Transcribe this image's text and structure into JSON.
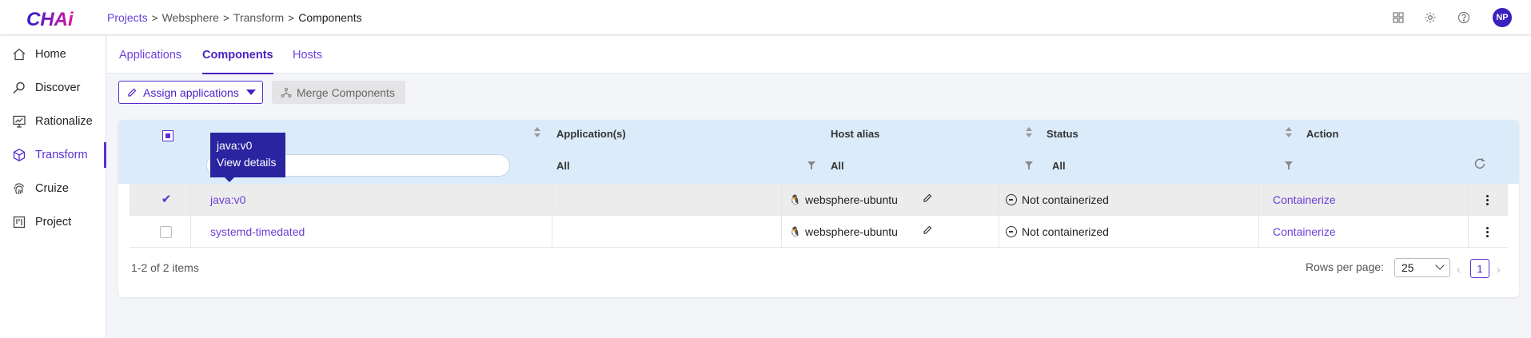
{
  "app": {
    "logo_text": "CHAi"
  },
  "breadcrumb": [
    "Projects",
    "Websphere",
    "Transform",
    "Components"
  ],
  "header_icons": [
    "grid-icon",
    "gear-icon",
    "help-icon"
  ],
  "user": {
    "initials": "NP"
  },
  "sidebar": {
    "items": [
      {
        "label": "Home",
        "icon": "home-icon"
      },
      {
        "label": "Discover",
        "icon": "magnifier-icon"
      },
      {
        "label": "Rationalize",
        "icon": "presentation-icon"
      },
      {
        "label": "Transform",
        "icon": "cube-icon",
        "active": true
      },
      {
        "label": "Cruize",
        "icon": "fingerprint-icon"
      },
      {
        "label": "Project",
        "icon": "kanban-icon"
      }
    ]
  },
  "tabs": [
    {
      "label": "Applications"
    },
    {
      "label": "Components",
      "active": true
    },
    {
      "label": "Hosts"
    }
  ],
  "toolbar": {
    "assign_label": "Assign applications",
    "merge_label": "Merge Components"
  },
  "table": {
    "columns": [
      "Application(s)",
      "Host alias",
      "Status",
      "Action"
    ],
    "filters": {
      "applications": "All",
      "host_alias": "All",
      "status": "All"
    },
    "rows": [
      {
        "component": "java:v0",
        "host": "websphere-ubuntu",
        "status": "Not containerized",
        "action": "Containerize",
        "checked": true
      },
      {
        "component": "systemd-timedated",
        "host": "websphere-ubuntu",
        "status": "Not containerized",
        "action": "Containerize",
        "checked": false
      }
    ],
    "tooltip": {
      "title": "java:v0",
      "subtitle": "View details"
    }
  },
  "pagination": {
    "summary": "1-2 of 2 items",
    "rows_per_page_label": "Rows per page:",
    "rows_per_page": "25",
    "current_page": "1"
  },
  "colors": {
    "accent": "#5a2fd0",
    "header_bg": "#dcebfa",
    "tooltip_bg": "#2a24a0"
  }
}
